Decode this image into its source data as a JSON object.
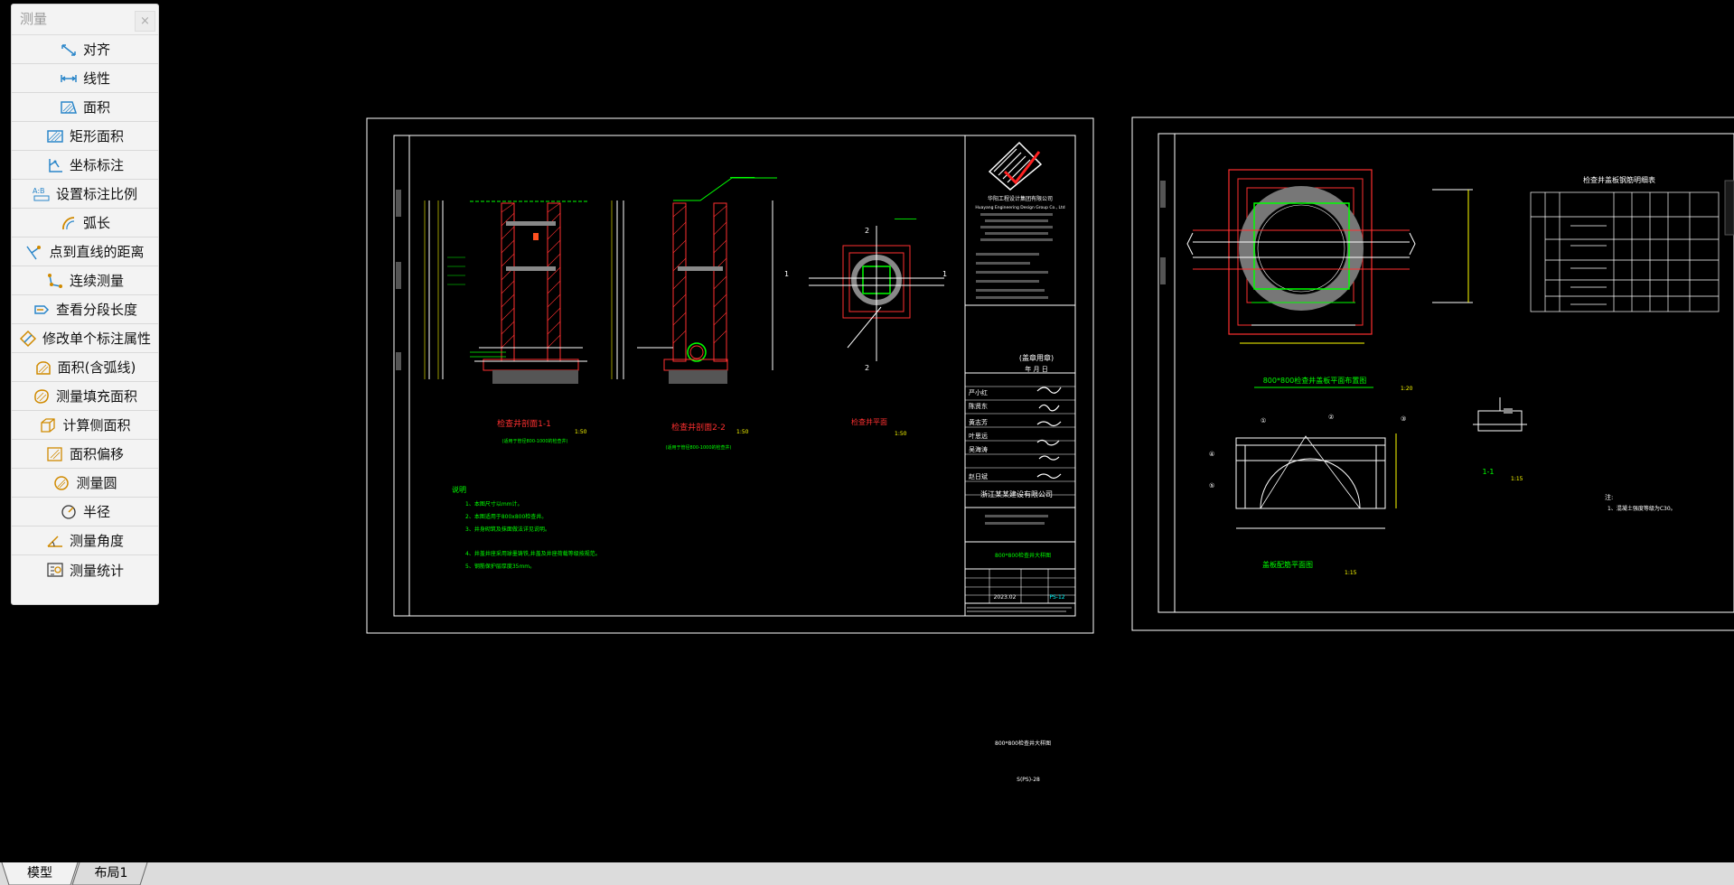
{
  "panel": {
    "title": "测量",
    "close": "×",
    "items": [
      {
        "label": "对齐",
        "icon": "aligned-dimension-icon"
      },
      {
        "label": "线性",
        "icon": "linear-dimension-icon"
      },
      {
        "label": "面积",
        "icon": "area-icon"
      },
      {
        "label": "矩形面积",
        "icon": "rect-area-icon"
      },
      {
        "label": "坐标标注",
        "icon": "coordinate-icon"
      },
      {
        "label": "设置标注比例",
        "icon": "scale-icon"
      },
      {
        "label": "弧长",
        "icon": "arc-length-icon"
      },
      {
        "label": "点到直线的距离",
        "icon": "point-line-distance-icon"
      },
      {
        "label": "连续测量",
        "icon": "continuous-measure-icon"
      },
      {
        "label": "查看分段长度",
        "icon": "segment-length-icon"
      },
      {
        "label": "修改单个标注属性",
        "icon": "edit-dimension-icon"
      },
      {
        "label": "面积(含弧线)",
        "icon": "arc-area-icon"
      },
      {
        "label": "测量填充面积",
        "icon": "hatch-area-icon"
      },
      {
        "label": "计算侧面积",
        "icon": "side-area-icon"
      },
      {
        "label": "面积偏移",
        "icon": "area-offset-icon"
      },
      {
        "label": "测量圆",
        "icon": "circle-icon"
      },
      {
        "label": "半径",
        "icon": "radius-icon"
      },
      {
        "label": "测量角度",
        "icon": "angle-icon"
      },
      {
        "label": "测量统计",
        "icon": "statistics-icon"
      }
    ]
  },
  "tabs": [
    "模型",
    "布局1"
  ],
  "sheet1": {
    "company_cn": "华阳工程设计集团有限公司",
    "company_en": "Huayang Engineering Design Group Co., Ltd",
    "section_1": "检查井剖面1-1",
    "section_2": "检查井剖面2-2",
    "plan": "检查井平面",
    "scale_a": "1:50",
    "scale_b": "1:50",
    "scale_c": "1:50",
    "note_sub_1": "(适用于管径800-1000的检查井)",
    "note_sub_2": "(适用于管径800-1000的检查井)",
    "notes_title": "说明",
    "notes": [
      "1、本图尺寸以mm计。",
      "2、本图适用于800x800检查井。",
      "3、井身砌筑及抹面做法详见说明。",
      "4、井盖井座采用球墨铸铁,井盖及井座荷载等级按规范。",
      "5、钢筋保护层厚度35mm。"
    ],
    "stamp": "(盖章用章)",
    "date_line": "年    月    日",
    "contractor": "浙江某某建设有限公司",
    "drawing_title": "800*800检查井大样图",
    "date": "2023.02",
    "drawing_no": "PS-12",
    "names": [
      "严小红",
      "陈贤东",
      "黄志芳",
      "叶思远",
      "吴海涛",
      "赵日斌"
    ],
    "under_title": "800*800检查井大样图",
    "under_no": "S(PS)-28"
  },
  "sheet2": {
    "plan_title": "800*800检查井盖板平面布置图",
    "plan_scale": "1:20",
    "section_title": "盖板配筋平面图",
    "section_scale": "1:15",
    "detail_title": "1-1",
    "detail_scale": "1:15",
    "table_title": "检查井盖板钢筋明细表",
    "note": "注:",
    "note_1": "1、混凝土强度等级为C30。"
  },
  "colors": {
    "cad_bg": "#000000",
    "panel_bg": "#f3f3f3",
    "green": "#00ff00",
    "red": "#ff2020",
    "white": "#ffffff"
  }
}
